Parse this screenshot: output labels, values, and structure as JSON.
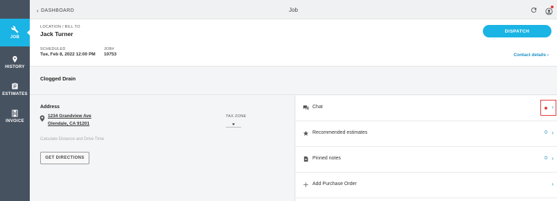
{
  "sidebar": {
    "items": [
      {
        "label": "JOB",
        "icon": "wrench-icon"
      },
      {
        "label": "HISTORY",
        "icon": "location-pin-icon"
      },
      {
        "label": "ESTIMATES",
        "icon": "clipboard-icon"
      },
      {
        "label": "INVOICE",
        "icon": "invoice-dollar-icon"
      }
    ]
  },
  "header": {
    "back_label": "DASHBOARD",
    "title": "Job"
  },
  "job": {
    "location_label": "LOCATION / BILL TO",
    "customer_name": "Jack Turner",
    "scheduled_label": "SCHEDULED",
    "scheduled_value": "Tue, Feb 8, 2022 12:00 PM",
    "job_num_label": "JOB#",
    "job_num_value": "10753",
    "dispatch_label": "DISPATCH",
    "contact_label": "Contact details",
    "job_name": "Clogged Drain"
  },
  "address": {
    "title": "Address",
    "line1": "1234 Grandview Ave",
    "line2": "Glendale, CA 91201",
    "tax_zone_label": "TAX ZONE",
    "calc_text": "Calculate Distance and Drive Time",
    "directions_label": "GET DIRECTIONS"
  },
  "panel": {
    "rows": [
      {
        "label": "Chat",
        "count": "",
        "icon": "chat-icon"
      },
      {
        "label": "Recommended estimates",
        "count": "0",
        "icon": "star-icon"
      },
      {
        "label": "Pinned notes",
        "count": "0",
        "icon": "note-icon"
      },
      {
        "label": "Add Purchase Order",
        "count": "",
        "icon": "plus-icon"
      }
    ]
  },
  "colors": {
    "accent": "#1ab4e5",
    "sidebar": "#475260",
    "alert": "#e03a3a"
  }
}
